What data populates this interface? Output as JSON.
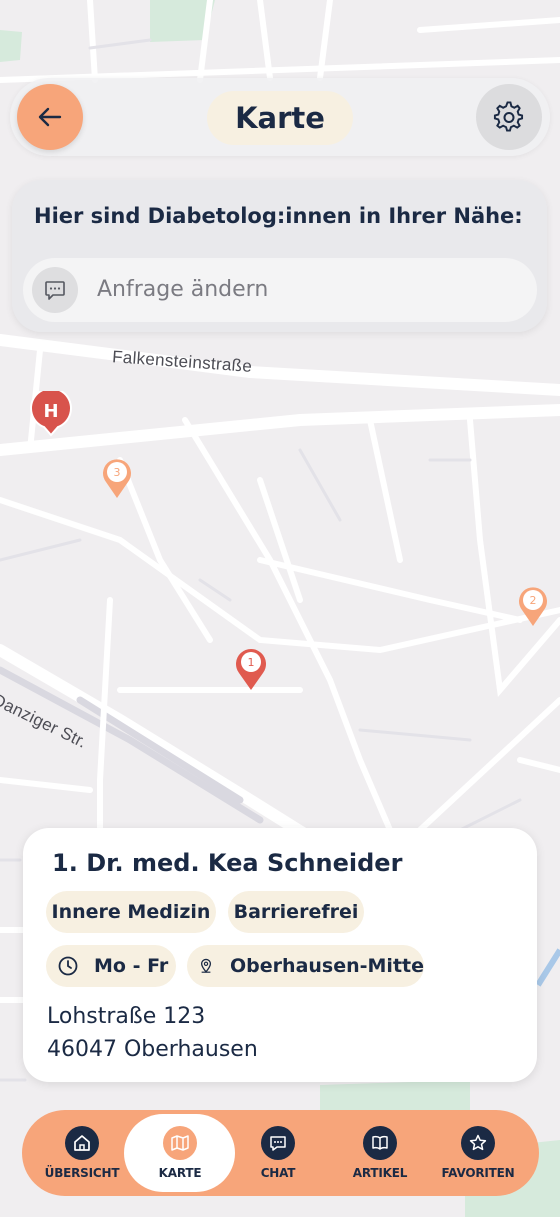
{
  "header": {
    "title": "Karte",
    "back_icon": "arrow-left-icon",
    "settings_icon": "gear-icon"
  },
  "query": {
    "heading": "Hier sind Diabetolog:innen in Ihrer Nähe:",
    "placeholder": "Anfrage ändern",
    "icon": "chat-bubble-icon"
  },
  "map": {
    "street_labels": [
      "Falkensteinstraße",
      "Danziger Str."
    ],
    "pins": [
      {
        "number": "1",
        "color": "#e05a4f"
      },
      {
        "number": "2",
        "color": "#f7a57a"
      },
      {
        "number": "3",
        "color": "#f7a57a"
      }
    ],
    "hospital_marker": "H"
  },
  "doctor_card": {
    "rank": "1.",
    "name": "Dr. med. Kea Schneider",
    "tags": [
      "Innere Medizin",
      "Barrierefrei"
    ],
    "hours": "Mo - Fr",
    "district": "Oberhausen-Mitte",
    "address_line1": "Lohstraße 123",
    "address_line2": "46047 Oberhausen"
  },
  "nav": {
    "items": [
      {
        "label": "ÜBERSICHT",
        "icon": "home-icon"
      },
      {
        "label": "KARTE",
        "icon": "map-icon",
        "active": true
      },
      {
        "label": "CHAT",
        "icon": "chat-icon"
      },
      {
        "label": "ARTIKEL",
        "icon": "book-icon"
      },
      {
        "label": "FAVORITEN",
        "icon": "star-icon"
      }
    ]
  },
  "colors": {
    "accent": "#f7a57a",
    "navy": "#1b2a44",
    "pill": "#f7f0e1",
    "pin_primary": "#e05a4f"
  }
}
